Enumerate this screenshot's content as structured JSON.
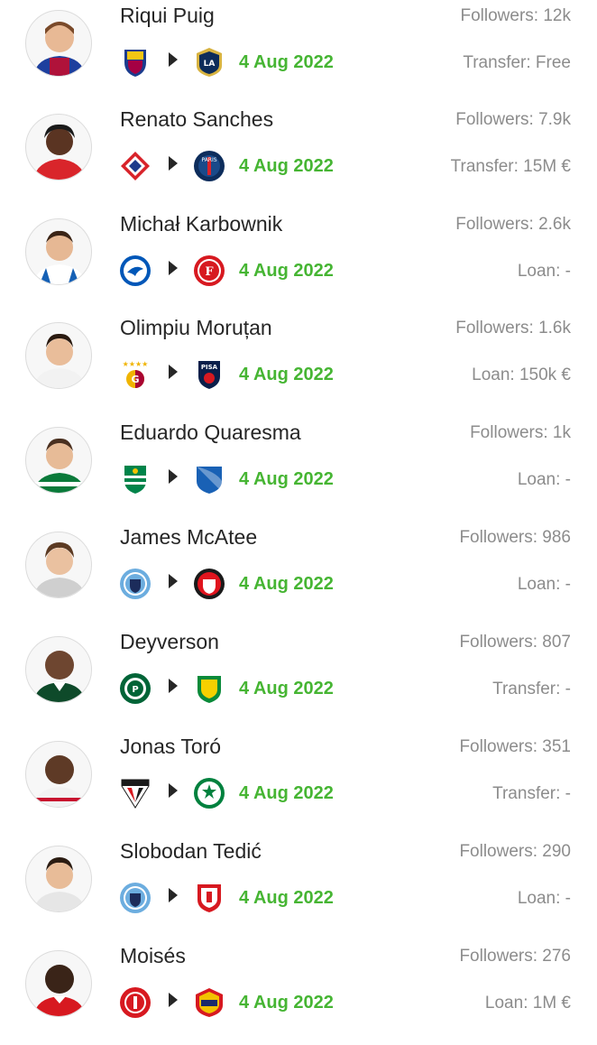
{
  "transfers": [
    {
      "player_name": "Riqui Puig",
      "followers": "Followers: 12k",
      "from_club_icon": "barcelona-crest-icon",
      "to_club_icon": "la-galaxy-crest-icon",
      "date": "4 Aug 2022",
      "fee": "Transfer: Free"
    },
    {
      "player_name": "Renato Sanches",
      "followers": "Followers: 7.9k",
      "from_club_icon": "lille-crest-icon",
      "to_club_icon": "psg-crest-icon",
      "date": "4 Aug 2022",
      "fee": "Transfer: 15M €"
    },
    {
      "player_name": "Michał Karbownik",
      "followers": "Followers: 2.6k",
      "from_club_icon": "brighton-crest-icon",
      "to_club_icon": "fortuna-dusseldorf-crest-icon",
      "date": "4 Aug 2022",
      "fee": "Loan: -"
    },
    {
      "player_name": "Olimpiu Moruțan",
      "followers": "Followers: 1.6k",
      "from_club_icon": "galatasaray-crest-icon",
      "to_club_icon": "pisa-crest-icon",
      "date": "4 Aug 2022",
      "fee": "Loan: 150k €"
    },
    {
      "player_name": "Eduardo Quaresma",
      "followers": "Followers: 1k",
      "from_club_icon": "sporting-cp-crest-icon",
      "to_club_icon": "hoffenheim-crest-icon",
      "date": "4 Aug 2022",
      "fee": "Loan: -"
    },
    {
      "player_name": "James McAtee",
      "followers": "Followers: 986",
      "from_club_icon": "manchester-city-crest-icon",
      "to_club_icon": "sheffield-united-crest-icon",
      "date": "4 Aug 2022",
      "fee": "Loan: -"
    },
    {
      "player_name": "Deyverson",
      "followers": "Followers: 807",
      "from_club_icon": "palmeiras-crest-icon",
      "to_club_icon": "cuiaba-crest-icon",
      "date": "4 Aug 2022",
      "fee": "Transfer: -"
    },
    {
      "player_name": "Jonas Toró",
      "followers": "Followers: 351",
      "from_club_icon": "sao-paulo-crest-icon",
      "to_club_icon": "panathinaikos-crest-icon",
      "date": "4 Aug 2022",
      "fee": "Transfer: -"
    },
    {
      "player_name": "Slobodan Tedić",
      "followers": "Followers: 290",
      "from_club_icon": "manchester-city-crest-icon",
      "to_club_icon": "barnsley-crest-icon",
      "date": "4 Aug 2022",
      "fee": "Loan: -"
    },
    {
      "player_name": "Moisés",
      "followers": "Followers: 276",
      "from_club_icon": "internacional-crest-icon",
      "to_club_icon": "cska-moscow-crest-icon",
      "date": "4 Aug 2022",
      "fee": "Loan: 1M €"
    }
  ],
  "colors": {
    "date": "#46b533",
    "name": "#262626",
    "secondary_text": "#8c8c8c",
    "arrow": "#262626"
  }
}
